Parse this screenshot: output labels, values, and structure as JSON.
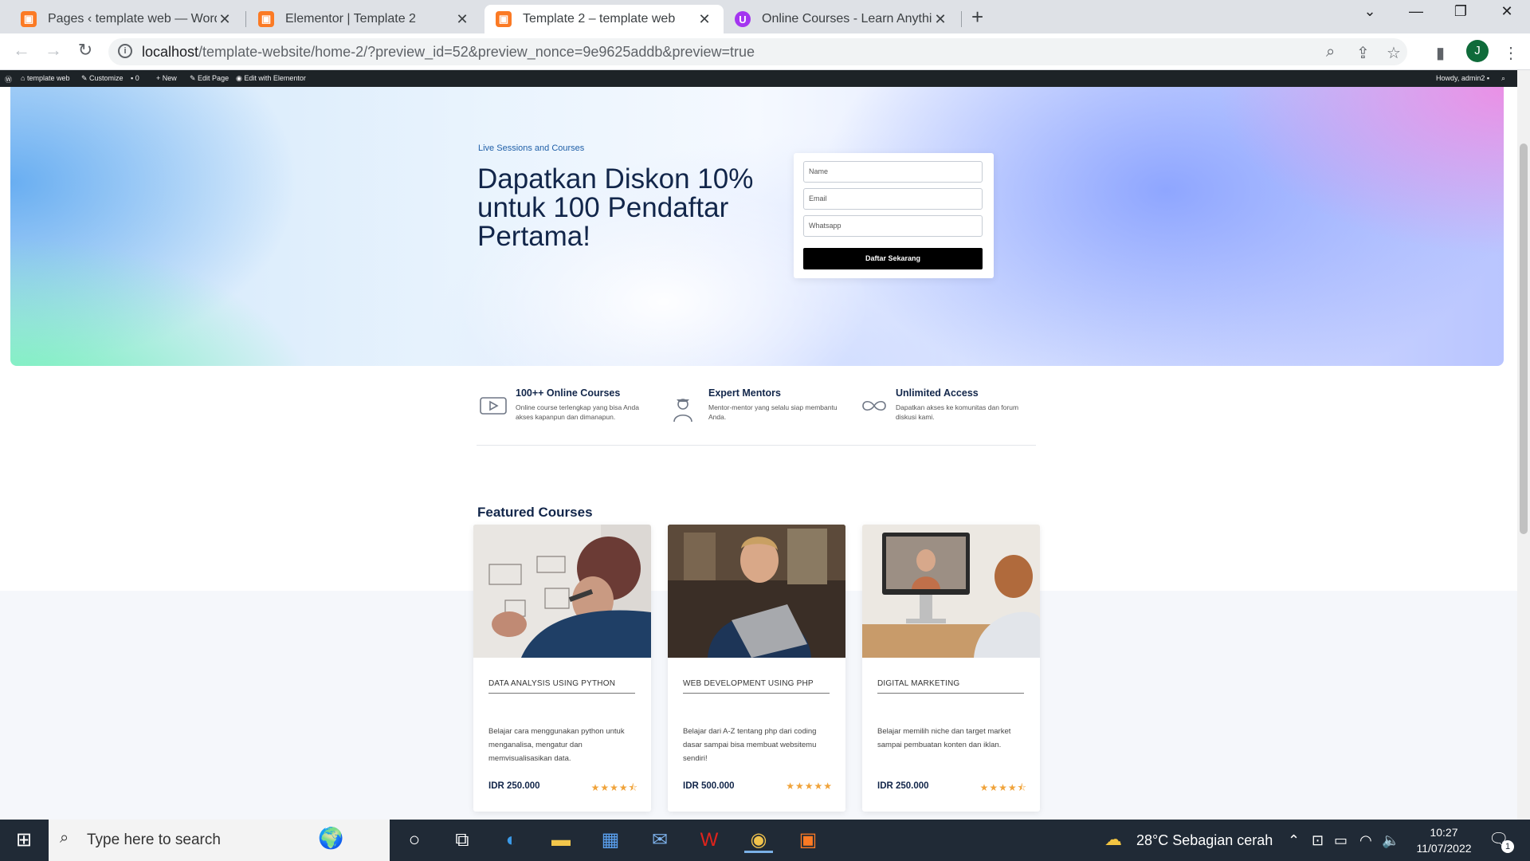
{
  "browser": {
    "tabs": [
      {
        "title": "Pages ‹ template web — WordPress",
        "favicon": "elementor-icon"
      },
      {
        "title": "Elementor | Template 2",
        "favicon": "elementor-icon"
      },
      {
        "title": "Template 2 – template web",
        "favicon": "elementor-icon",
        "active": true
      },
      {
        "title": "Online Courses - Learn Anything",
        "favicon": "udemy-icon"
      }
    ],
    "url_host": "localhost",
    "url_path": "/template-website/home-2/?preview_id=52&preview_nonce=9e9625addb&preview=true",
    "profile_initial": "J"
  },
  "wpbar": {
    "site": "template web",
    "customize": "Customize",
    "comments": "0",
    "new": "New",
    "edit_page": "Edit Page",
    "edit_elementor": "Edit with Elementor",
    "howdy": "Howdy, admin2"
  },
  "hero": {
    "kicker": "Live Sessions and Courses",
    "headline": "Dapatkan Diskon 10% untuk 100 Pendaftar Pertama!",
    "form": {
      "name_placeholder": "Name",
      "email_placeholder": "Email",
      "whatsapp_placeholder": "Whatsapp",
      "submit_label": "Daftar Sekarang"
    }
  },
  "features": [
    {
      "icon": "play-video-icon",
      "title": "100++ Online Courses",
      "desc": "Online course terlengkap yang bisa Anda akses kapanpun dan dimanapun."
    },
    {
      "icon": "mentor-icon",
      "title": "Expert Mentors",
      "desc": "Mentor-mentor yang selalu siap membantu Anda."
    },
    {
      "icon": "infinity-icon",
      "title": "Unlimited Access",
      "desc": "Dapatkan akses ke komunitas dan forum diskusi kami."
    }
  ],
  "featured": {
    "heading": "Featured Courses",
    "courses": [
      {
        "title": "DATA ANALYSIS USING PYTHON",
        "desc": "Belajar cara menggunakan python untuk menganalisa, mengatur dan memvisualisasikan data.",
        "price": "IDR 250.000",
        "rating": 4.5
      },
      {
        "title": "WEB DEVELOPMENT USING PHP",
        "desc": "Belajar dari A-Z tentang php dari coding dasar sampai bisa membuat websitemu sendiri!",
        "price": "IDR 500.000",
        "rating": 5
      },
      {
        "title": "DIGITAL MARKETING",
        "desc": "Belajar memilih niche dan target market sampai pembuatan konten dan iklan.",
        "price": "IDR 250.000",
        "rating": 4.5
      }
    ]
  },
  "taskbar": {
    "search_placeholder": "Type here to search",
    "weather": "28°C  Sebagian cerah",
    "time": "10:27",
    "date": "11/07/2022",
    "notifications": "1"
  },
  "colors": {
    "accent": "#12264a",
    "button": "#000000",
    "star": "#f0a33a"
  }
}
